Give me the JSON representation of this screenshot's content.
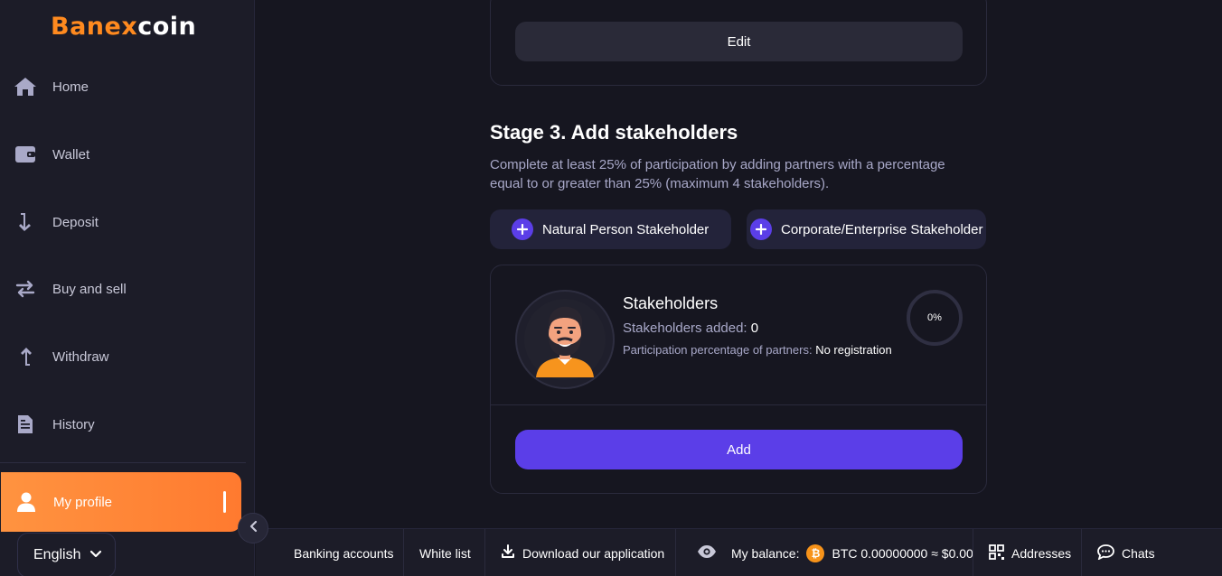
{
  "brand": {
    "logo_part1": "Banex",
    "logo_part2": "coin"
  },
  "sidebar": {
    "items": [
      {
        "label": "Home",
        "icon": "home-icon"
      },
      {
        "label": "Wallet",
        "icon": "wallet-icon"
      },
      {
        "label": "Deposit",
        "icon": "deposit-arrow-icon"
      },
      {
        "label": "Buy and sell",
        "icon": "swap-arrows-icon"
      },
      {
        "label": "Withdraw",
        "icon": "withdraw-arrow-icon"
      },
      {
        "label": "History",
        "icon": "document-icon"
      },
      {
        "label": "My profile",
        "icon": "user-icon",
        "active": true
      }
    ],
    "language": "English"
  },
  "top_card": {
    "edit_label": "Edit"
  },
  "stage": {
    "title": "Stage 3. Add stakeholders",
    "description": "Complete at least 25% of participation by adding partners with a percentage equal to or greater than 25% (maximum 4 stakeholders).",
    "options": [
      {
        "label": "Natural Person Stakeholder"
      },
      {
        "label": "Corporate/Enterprise Stakeholder"
      }
    ]
  },
  "stakeholders": {
    "title": "Stakeholders",
    "added_label": "Stakeholders added:",
    "added_value": "0",
    "percentage_label": "Participation percentage of partners:",
    "percentage_value": "No registration",
    "progress_text": "0%",
    "progress": 0,
    "add_label": "Add"
  },
  "bottom_bar": {
    "banking": "Banking accounts",
    "whitelist": "White list",
    "download": "Download our application",
    "balance_label": "My balance:",
    "balance_value": "BTC 0.00000000 ≈ $0.00",
    "addresses": "Addresses",
    "chats": "Chats"
  },
  "colors": {
    "accent": "#ff8a1f",
    "primary": "#5b3ee8",
    "background": "#161620",
    "sidebar": "#1c1c28"
  }
}
